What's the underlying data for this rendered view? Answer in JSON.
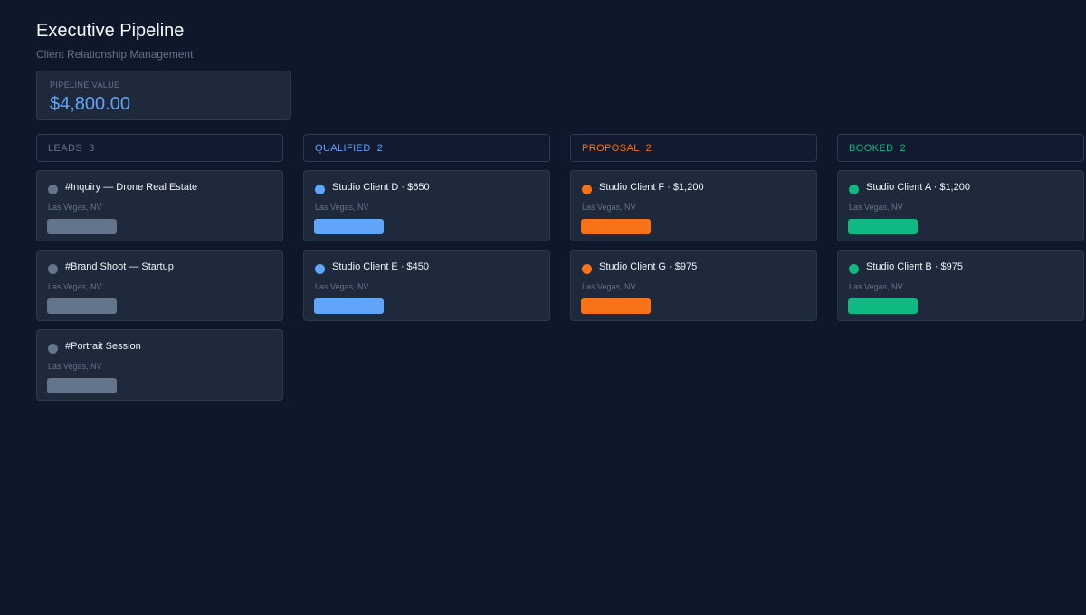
{
  "header": {
    "title": "Executive Pipeline",
    "subtitle": "Client Relationship Management"
  },
  "kpi": {
    "label": "PIPELINE VALUE",
    "value": "$4,800.00"
  },
  "colors": {
    "background": "#0f172a",
    "panel": "#1e293b",
    "border": "#2a3a52",
    "leads": "#64748b",
    "qualified": "#60a5fa",
    "proposal": "#f97316",
    "booked": "#10b981"
  },
  "columns": [
    {
      "key": "leads",
      "label": "LEADS",
      "count": "3",
      "cards": [
        {
          "title": "#Inquiry — Drone Real Estate",
          "location": "Las Vegas, NV"
        },
        {
          "title": "#Brand Shoot — Startup",
          "location": "Las Vegas, NV"
        },
        {
          "title": "#Portrait Session",
          "location": "Las Vegas, NV"
        }
      ]
    },
    {
      "key": "qualified",
      "label": "QUALIFIED",
      "count": "2",
      "cards": [
        {
          "title": "Studio Client D · $650",
          "location": "Las Vegas, NV"
        },
        {
          "title": "Studio Client E · $450",
          "location": "Las Vegas, NV"
        }
      ]
    },
    {
      "key": "proposal",
      "label": "PROPOSAL",
      "count": "2",
      "cards": [
        {
          "title": "Studio Client F · $1,200",
          "location": "Las Vegas, NV"
        },
        {
          "title": "Studio Client G · $975",
          "location": "Las Vegas, NV"
        }
      ]
    },
    {
      "key": "booked",
      "label": "BOOKED",
      "count": "2",
      "cards": [
        {
          "title": "Studio Client A · $1,200",
          "location": "Las Vegas, NV"
        },
        {
          "title": "Studio Client B · $975",
          "location": "Las Vegas, NV"
        }
      ]
    }
  ]
}
